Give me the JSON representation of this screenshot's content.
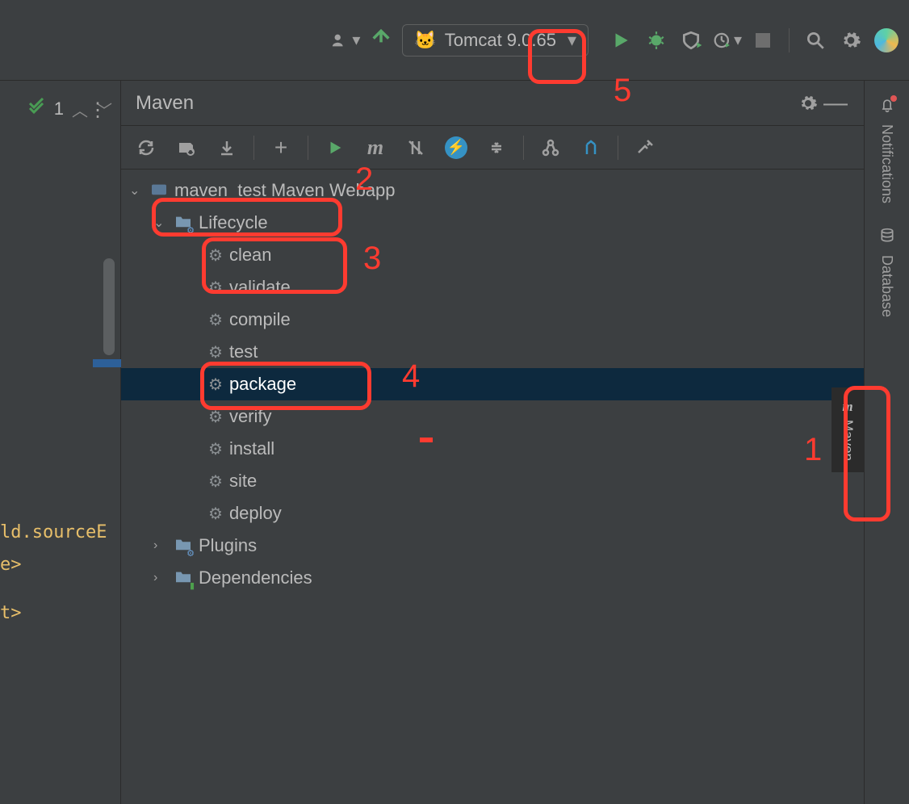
{
  "toolbar": {
    "run_config_label": "Tomcat 9.0.65"
  },
  "left": {
    "gutter_count": "1",
    "code_line_1": "ld.sourceE",
    "code_line_2": "e>",
    "code_line_3": "t>"
  },
  "maven": {
    "title": "Maven",
    "project_label": "maven_test Maven Webapp",
    "lifecycle_label": "Lifecycle",
    "goals": [
      "clean",
      "validate",
      "compile",
      "test",
      "package",
      "verify",
      "install",
      "site",
      "deploy"
    ],
    "plugins_label": "Plugins",
    "dependencies_label": "Dependencies",
    "selected_goal_index": 4
  },
  "rail": {
    "notifications": "Notifications",
    "database": "Database",
    "maven_tab": "Maven",
    "maven_m": "m"
  },
  "annotations": {
    "n1": "1",
    "n2": "2",
    "n3": "3",
    "n4": "4",
    "n5": "5"
  }
}
